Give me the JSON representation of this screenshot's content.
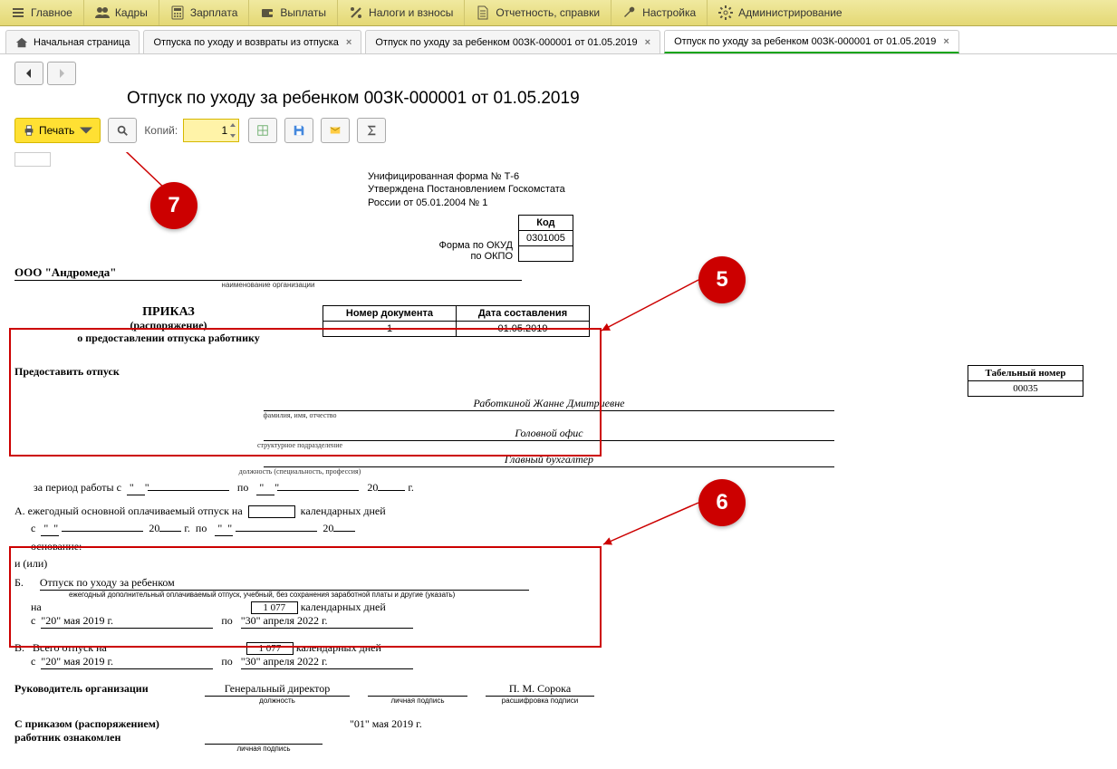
{
  "top_menu": {
    "main": "Главное",
    "hr": "Кадры",
    "salary": "Зарплата",
    "payments": "Выплаты",
    "taxes": "Налоги и взносы",
    "reports": "Отчетность, справки",
    "settings": "Настройка",
    "admin": "Администрирование"
  },
  "tabs": {
    "home": "Начальная страница",
    "t1": "Отпуска по уходу и возвраты из отпуска",
    "t2": "Отпуск по уходу за ребенком 00ЗК-000001 от 01.05.2019",
    "t3": "Отпуск по уходу за ребенком 00ЗК-000001 от 01.05.2019"
  },
  "page_title": "Отпуск по уходу за ребенком 00ЗК-000001 от 01.05.2019",
  "toolbar": {
    "print": "Печать",
    "copies_lbl": "Копий:",
    "copies_val": "1"
  },
  "form": {
    "std1": "Унифицированная форма № Т-6",
    "std2": "Утверждена Постановлением Госкомстата",
    "std3": "России от 05.01.2004 № 1",
    "kod": "Код",
    "okud_lbl": "Форма по ОКУД",
    "okud": "0301005",
    "okpo_lbl": "по ОКПО",
    "org": "ООО \"Андромеда\"",
    "org_sub": "наименование организации",
    "order": "ПРИКАЗ",
    "decree": "(распоряжение)",
    "about": "о предоставлении отпуска работнику",
    "docnum_h": "Номер документа",
    "docnum": "1",
    "docdate_h": "Дата составления",
    "docdate": "01.05.2019",
    "grant": "Предоставить отпуск",
    "tabnum_h": "Табельный номер",
    "tabnum": "00035",
    "fio": "Работкиной Жанне Дмитриевне",
    "fio_sub": "фамилия, имя, отчество",
    "dept": "Головной офис",
    "dept_sub": "структурное подразделение",
    "pos": "Главный бухгалтер",
    "pos_sub": "должность (специальность, профессия)",
    "period": "за период работы с",
    "po": "по",
    "year": "20",
    "g": "г.",
    "A": "А. ежегодный основной оплачиваемый отпуск на",
    "A_days": "календарных дней",
    "A_from": "с",
    "A_to": "по",
    "A_basis": "основание:",
    "or": "и (или)",
    "B": "Б.",
    "B_type": "Отпуск по уходу за ребенком",
    "B_sub": "ежегодный дополнительный оплачиваемый отпуск, учебный, без сохранения заработной платы и другие (указать)",
    "B_na": "на",
    "B_days": "1 077",
    "B_days_lbl": "календарных дней",
    "B_from": "\"20\" мая 2019 г.",
    "B_to": "\"30\" апреля 2022 г.",
    "V": "В.",
    "V_txt": "Всего отпуск на",
    "V_days": "1 077",
    "V_days_lbl": "календарных дней",
    "V_from": "\"20\" мая 2019 г.",
    "V_to": "\"30\" апреля 2022 г.",
    "head": "Руководитель организации",
    "head_pos": "Генеральный директор",
    "head_pos_sub": "должность",
    "sig_sub": "личная подпись",
    "head_name": "П. М. Сорока",
    "name_sub": "расшифровка подписи",
    "ack1": "С приказом (распоряжением)",
    "ack2": "работник  ознакомлен",
    "ack_date": "\"01\" мая 2019 г."
  },
  "badges": {
    "b5": "5",
    "b6": "6",
    "b7": "7"
  }
}
